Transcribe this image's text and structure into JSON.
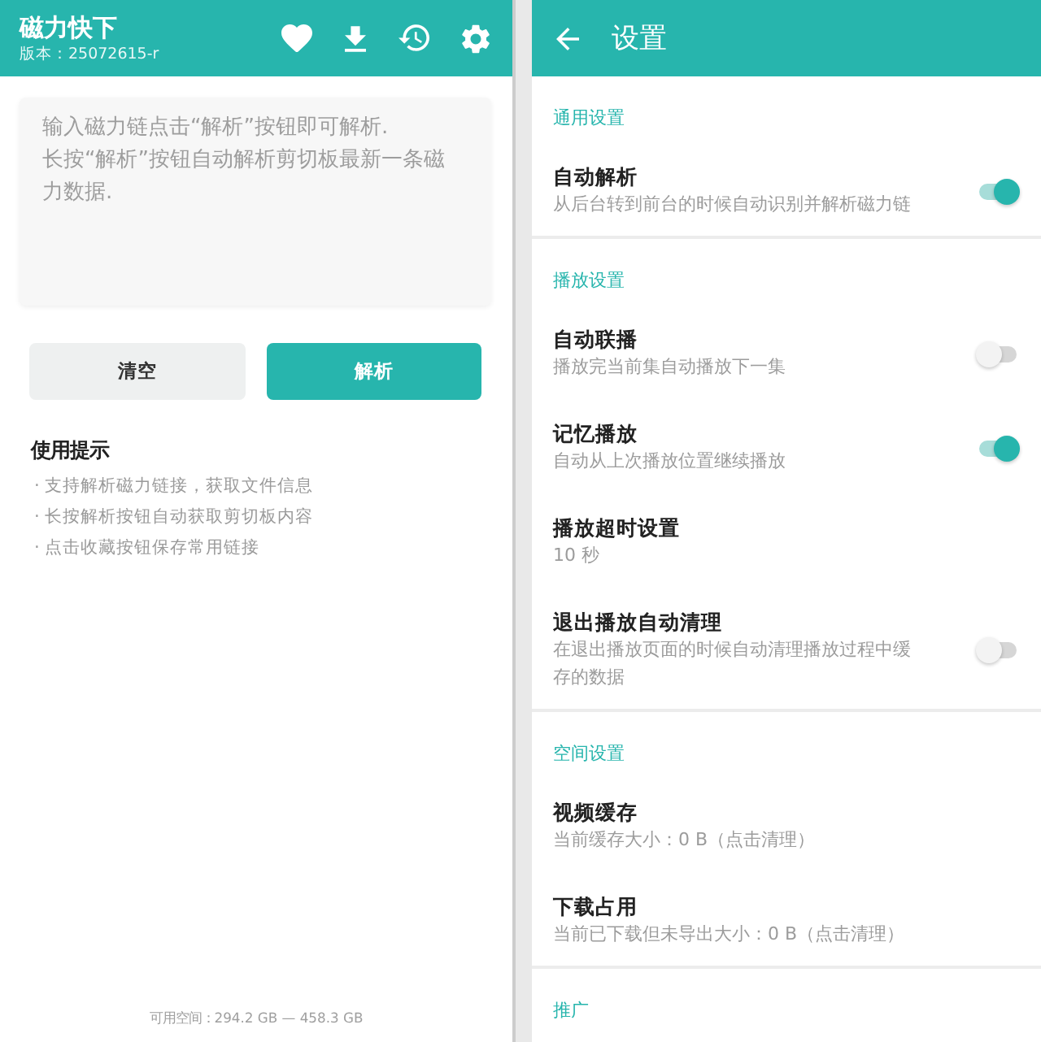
{
  "main_screen": {
    "app_bar": {
      "title": "磁力快下",
      "version": "版本：25072615-r"
    },
    "link_field": {
      "placeholder": "输入磁力链点击“解析”按钮即可解析.\n长按“解析”按钮自动解析剪切板最新一条磁力数据."
    },
    "buttons": [
      {
        "label": "清空",
        "kind": "secondary"
      },
      {
        "label": "解析",
        "kind": "primary"
      }
    ],
    "tips": {
      "title": "使用提示",
      "items": [
        "· 支持解析磁力链接，获取文件信息",
        "· 长按解析按钮自动获取剪切板内容",
        "· 点击收藏按钮保存常用链接"
      ]
    },
    "storage": "可用空间：294.2 GB — 458.3 GB"
  },
  "settings_screen": {
    "app_bar": {
      "title": "设置"
    },
    "sections": [
      {
        "title": "通用设置",
        "items": [
          {
            "kind": "switch",
            "title": "自动解析",
            "subtitle": "从后台转到前台的时候自动识别并解析磁力链",
            "on": true
          }
        ]
      },
      {
        "title": "播放设置",
        "items": [
          {
            "kind": "switch",
            "title": "自动联播",
            "subtitle": "播放完当前集自动播放下一集",
            "on": false
          },
          {
            "kind": "switch",
            "title": "记忆播放",
            "subtitle": "自动从上次播放位置继续播放",
            "on": true
          },
          {
            "kind": "value",
            "title": "播放超时设置",
            "subtitle": "10 秒"
          },
          {
            "kind": "switch",
            "title": "退出播放自动清理",
            "subtitle": "在退出播放页面的时候自动清理播放过程中缓存的数据",
            "on": false
          }
        ]
      },
      {
        "title": "空间设置",
        "items": [
          {
            "kind": "value",
            "title": "视频缓存",
            "subtitle": "当前缓存大小：0 B（点击清理）"
          },
          {
            "kind": "value",
            "title": "下载占用",
            "subtitle": "当前已下载但未导出大小：0 B（点击清理）"
          }
        ]
      },
      {
        "title": "推广"
      }
    ]
  }
}
